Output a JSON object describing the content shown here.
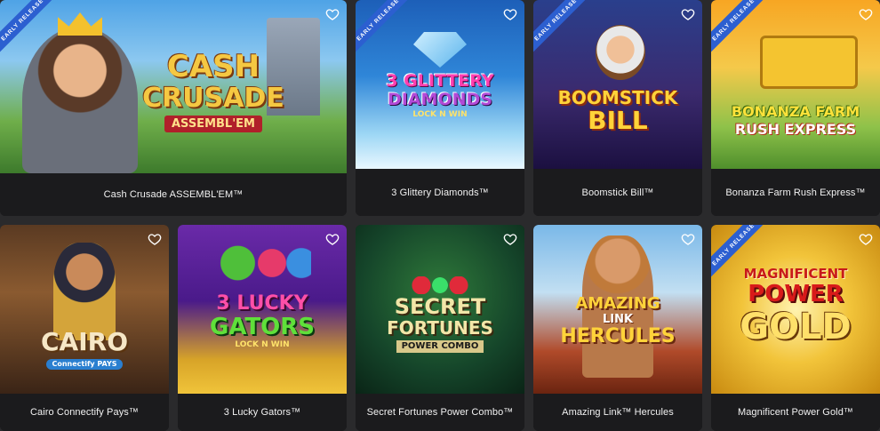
{
  "games": [
    {
      "title": "Cash Crusade ASSEMBL'EM™",
      "early_release": true,
      "ribbon_label": "EARLY RELEASE",
      "logo_lines": [
        "CASH",
        "CRUSADE",
        "ASSEMBL'EM"
      ]
    },
    {
      "title": "3 Glittery Diamonds™",
      "early_release": true,
      "ribbon_label": "EARLY RELEASE",
      "logo_lines": [
        "3 GLITTERY",
        "DIAMONDS",
        "LOCK N WIN"
      ]
    },
    {
      "title": "Boomstick Bill™",
      "early_release": true,
      "ribbon_label": "EARLY RELEASE",
      "logo_lines": [
        "BOOMSTICK",
        "BILL"
      ]
    },
    {
      "title": "Bonanza Farm Rush Express™",
      "early_release": true,
      "ribbon_label": "EARLY RELEASE",
      "logo_lines": [
        "BONANZA FARM",
        "RUSH EXPRESS"
      ]
    },
    {
      "title": "Cairo Connectify Pays™",
      "early_release": false,
      "logo_lines": [
        "CAIRO",
        "Connectify PAYS"
      ]
    },
    {
      "title": "3 Lucky Gators™",
      "early_release": false,
      "logo_lines": [
        "3 LUCKY",
        "GATORS",
        "LOCK N WIN"
      ]
    },
    {
      "title": "Secret Fortunes Power Combo™",
      "early_release": false,
      "logo_lines": [
        "SECRET",
        "FORTUNES",
        "POWER COMBO"
      ]
    },
    {
      "title": "Amazing Link™ Hercules",
      "early_release": false,
      "logo_lines": [
        "AMAZING",
        "LINK",
        "HERCULES"
      ]
    },
    {
      "title": "Magnificent Power Gold™",
      "early_release": true,
      "ribbon_label": "EARLY RELEASE",
      "logo_lines": [
        "MAGNIFICENT",
        "POWER",
        "GOLD"
      ]
    }
  ],
  "icons": {
    "favorite": "heart-outline-icon"
  },
  "colors": {
    "page_bg": "#2a2a2c",
    "card_bg": "#1b1b1d",
    "caption_text": "#f2f2f2",
    "ribbon": "#2c5fd0"
  }
}
